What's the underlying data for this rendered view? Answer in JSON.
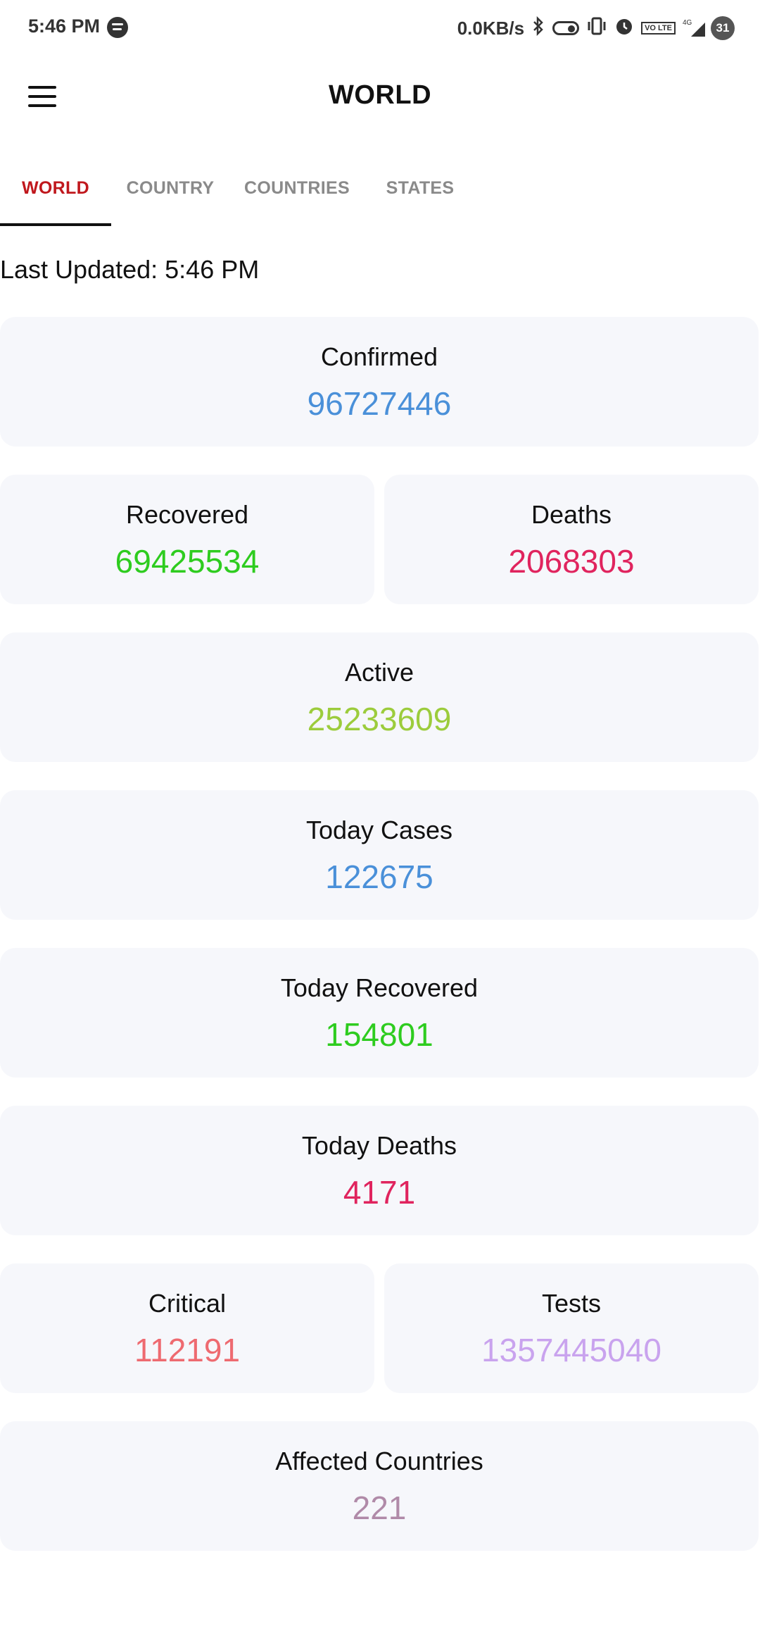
{
  "status_bar": {
    "time": "5:46 PM",
    "net_speed": "0.0KB/s",
    "volte": "VO LTE",
    "network": "4G",
    "battery": "31"
  },
  "app_bar": {
    "title": "WORLD"
  },
  "tabs": [
    {
      "label": "WORLD",
      "active": true
    },
    {
      "label": "COUNTRY",
      "active": false
    },
    {
      "label": "COUNTRIES",
      "active": false
    },
    {
      "label": "STATES",
      "active": false
    }
  ],
  "last_updated": "Last Updated: 5:46 PM",
  "stats": {
    "confirmed": {
      "label": "Confirmed",
      "value": "96727446",
      "color": "#4a90d9"
    },
    "recovered": {
      "label": "Recovered",
      "value": "69425534",
      "color": "#2ecc1f"
    },
    "deaths": {
      "label": "Deaths",
      "value": "2068303",
      "color": "#e0245e"
    },
    "active": {
      "label": "Active",
      "value": "25233609",
      "color": "#9ccc3c"
    },
    "today_cases": {
      "label": "Today Cases",
      "value": "122675",
      "color": "#4a90d9"
    },
    "today_recovered": {
      "label": "Today Recovered",
      "value": "154801",
      "color": "#2ecc1f"
    },
    "today_deaths": {
      "label": "Today Deaths",
      "value": "4171",
      "color": "#e0245e"
    },
    "critical": {
      "label": "Critical",
      "value": "112191",
      "color": "#ee6a70"
    },
    "tests": {
      "label": "Tests",
      "value": "1357445040",
      "color": "#c9a3ee"
    },
    "affected_countries": {
      "label": "Affected Countries",
      "value": "221",
      "color": "#b08aa8"
    }
  }
}
